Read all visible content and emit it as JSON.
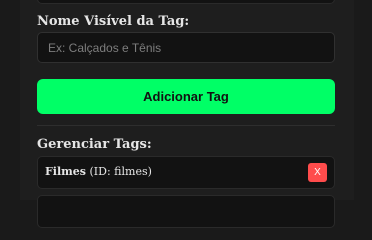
{
  "form": {
    "tag_name_label": "Nome Visível da Tag:",
    "tag_name_placeholder": "Ex: Calçados e Tênis",
    "tag_name_value": "",
    "add_button_label": "Adicionar Tag"
  },
  "manage": {
    "label": "Gerenciar Tags:",
    "tags": [
      {
        "name": "Filmes",
        "id_text": "(ID: filmes)",
        "remove_label": "X"
      }
    ]
  },
  "colors": {
    "background": "#1e1e1e",
    "accent": "#00ff66",
    "danger": "#ff4c4c",
    "input_background": "#121212"
  }
}
